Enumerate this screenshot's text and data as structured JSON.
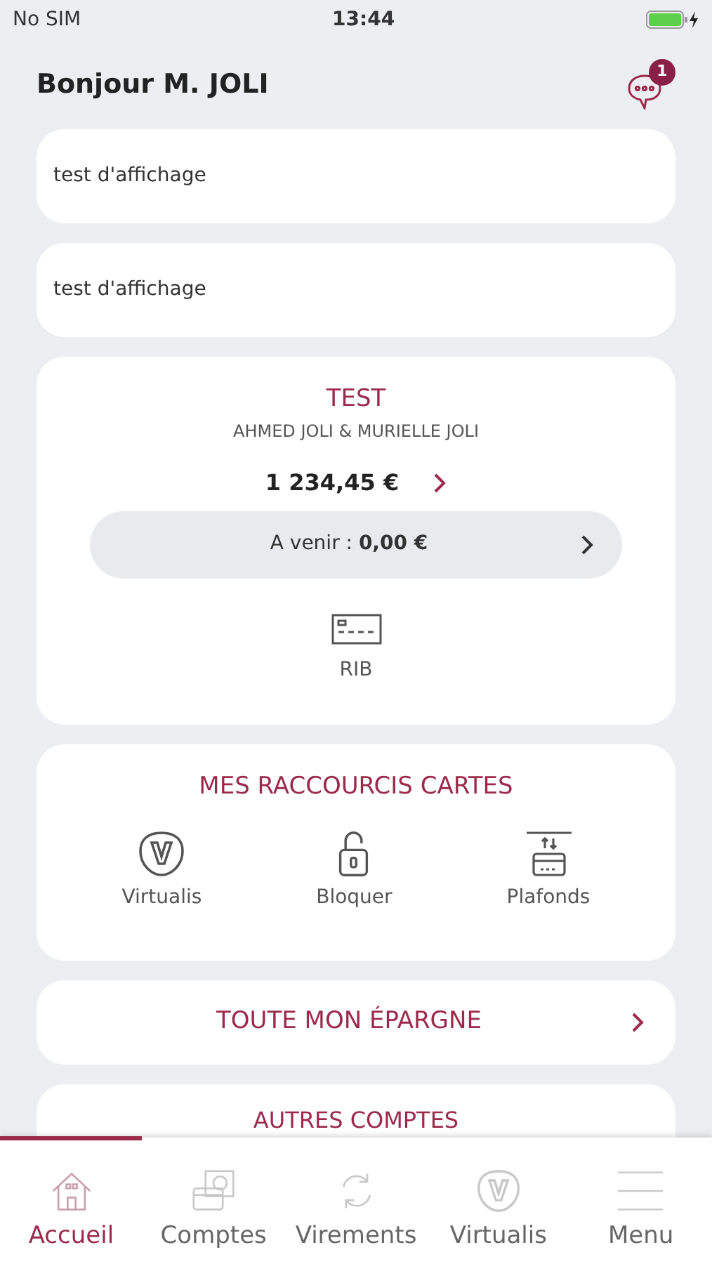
{
  "status_bar": {
    "carrier": "No SIM",
    "time": "13:44"
  },
  "header": {
    "greeting": "Bonjour M. JOLI",
    "notification_count": "1"
  },
  "messages": [
    "test d'affichage",
    "test d'affichage"
  ],
  "account": {
    "name": "TEST",
    "holders": "AHMED JOLI & MURIELLE JOLI",
    "balance": "1 234,45 €",
    "upcoming_label": "A venir :",
    "upcoming_amount": "0,00 €",
    "rib_label": "RIB"
  },
  "card_shortcuts": {
    "title": "MES RACCOURCIS CARTES",
    "items": [
      {
        "kind": "virtualis",
        "label": "Virtualis"
      },
      {
        "kind": "lock",
        "label": "Bloquer"
      },
      {
        "kind": "limits",
        "label": "Plafonds"
      }
    ]
  },
  "savings": {
    "title": "TOUTE MON ÉPARGNE"
  },
  "other_accounts": {
    "title": "AUTRES COMPTES"
  },
  "tabs": [
    {
      "kind": "home",
      "label": "Accueil",
      "selected": true
    },
    {
      "kind": "accounts",
      "label": "Comptes",
      "selected": false
    },
    {
      "kind": "transfers",
      "label": "Virements",
      "selected": false
    },
    {
      "kind": "virtualis",
      "label": "Virtualis",
      "selected": false
    },
    {
      "kind": "menu",
      "label": "Menu",
      "selected": false
    }
  ]
}
